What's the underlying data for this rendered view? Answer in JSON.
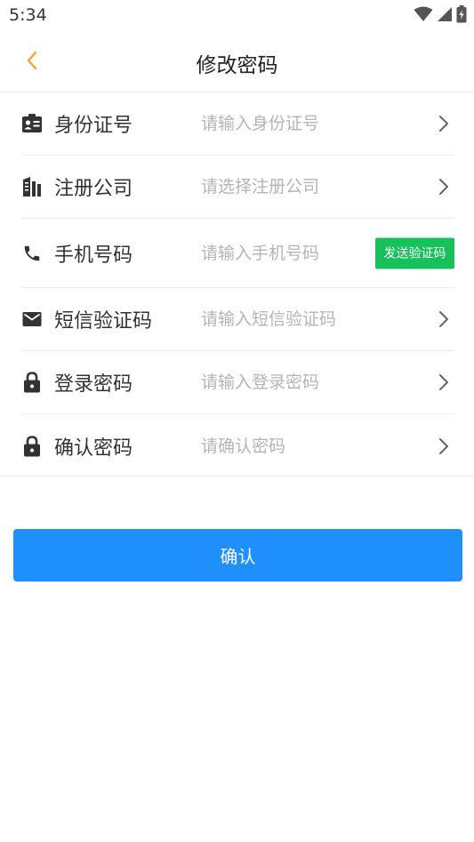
{
  "status_bar": {
    "time": "5:34",
    "icons": [
      "wifi-icon",
      "cell-signal-icon",
      "battery-charging-icon"
    ]
  },
  "nav": {
    "back_icon": "chevron-left-icon",
    "title": "修改密码",
    "accent_color": "#f5a623"
  },
  "form": {
    "rows": [
      {
        "icon": "id-card-icon",
        "label": "身份证号",
        "placeholder": "请输入身份证号",
        "value": ""
      },
      {
        "icon": "building-icon",
        "label": "注册公司",
        "placeholder": "请选择注册公司",
        "value": ""
      },
      {
        "icon": "phone-icon",
        "label": "手机号码",
        "placeholder": "请输入手机号码",
        "value": "",
        "action_label": "发送验证码"
      },
      {
        "icon": "mail-icon",
        "label": "短信验证码",
        "placeholder": "请输入短信验证码",
        "value": ""
      },
      {
        "icon": "lock-icon",
        "label": "登录密码",
        "placeholder": "请输入登录密码",
        "value": ""
      },
      {
        "icon": "lock-icon",
        "label": "确认密码",
        "placeholder": "请确认密码",
        "value": ""
      }
    ]
  },
  "confirm_button": {
    "label": "确认",
    "color": "#1e8ffb"
  },
  "send_code_color": "#16c05b"
}
